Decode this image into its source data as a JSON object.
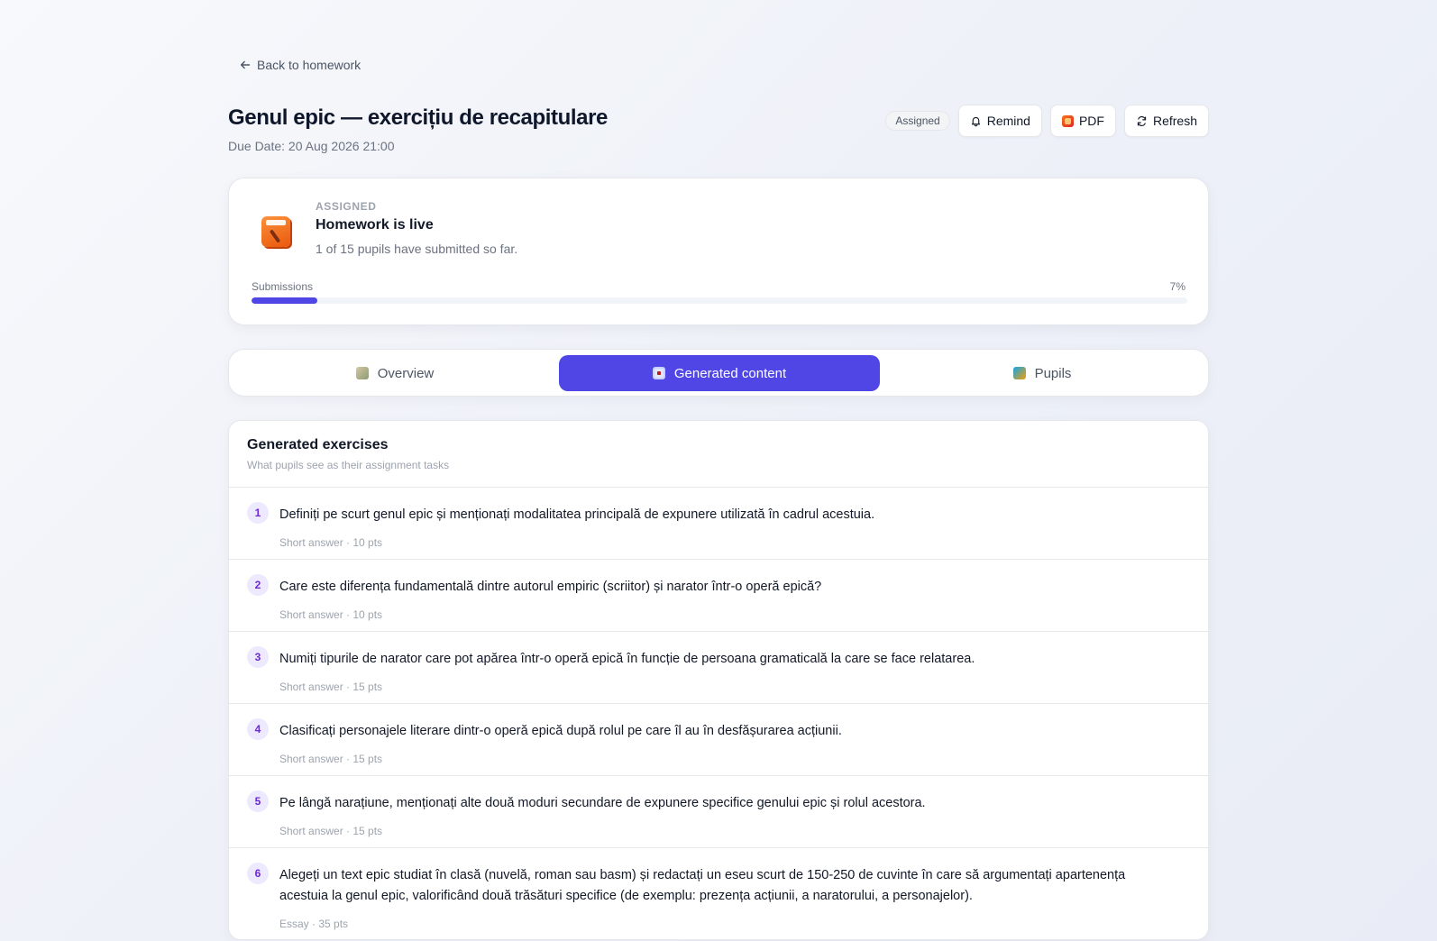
{
  "nav": {
    "back_label": "Back to homework"
  },
  "header": {
    "title": "Genul epic — exercițiu de recapitulare",
    "due_date": "Due Date: 20 Aug 2026 21:00",
    "status_badge": "Assigned",
    "buttons": {
      "remind": "Remind",
      "pdf": "PDF",
      "refresh": "Refresh"
    }
  },
  "status_card": {
    "label": "ASSIGNED",
    "heading": "Homework is live",
    "subtext": "1 of 15 pupils have submitted so far.",
    "progress_label": "Submissions",
    "progress_percent": "7%",
    "progress_fraction": 0.07,
    "icon": "notebook-icon"
  },
  "tabs": [
    {
      "label": "Overview",
      "icon": "overview-icon",
      "active": false
    },
    {
      "label": "Generated content",
      "icon": "generated-content-icon",
      "active": true
    },
    {
      "label": "Pupils",
      "icon": "pupils-icon",
      "active": false
    }
  ],
  "exercises": {
    "title": "Generated exercises",
    "subtitle": "What pupils see as their assignment tasks",
    "items": [
      {
        "number": "1",
        "text": "Definiți pe scurt genul epic și menționați modalitatea principală de expunere utilizată în cadrul acestuia.",
        "meta": "Short answer · 10 pts"
      },
      {
        "number": "2",
        "text": "Care este diferența fundamentală dintre autorul empiric (scriitor) și narator într-o operă epică?",
        "meta": "Short answer · 10 pts"
      },
      {
        "number": "3",
        "text": "Numiți tipurile de narator care pot apărea într-o operă epică în funcție de persoana gramaticală la care se face relatarea.",
        "meta": "Short answer · 15 pts"
      },
      {
        "number": "4",
        "text": "Clasificați personajele literare dintr-o operă epică după rolul pe care îl au în desfășurarea acțiunii.",
        "meta": "Short answer · 15 pts"
      },
      {
        "number": "5",
        "text": "Pe lângă narațiune, menționați alte două moduri secundare de expunere specifice genului epic și rolul acestora.",
        "meta": "Short answer · 15 pts"
      },
      {
        "number": "6",
        "text": "Alegeți un text epic studiat în clasă (nuvelă, roman sau basm) și redactați un eseu scurt de 150-250 de cuvinte în care să argumentați apartenența acestuia la genul epic, valorificând două trăsături specifice (de exemplu: prezența acțiunii, a naratorului, a personajelor).",
        "meta": "Essay · 35 pts"
      }
    ]
  },
  "colors": {
    "accent": "#4f46e5",
    "number_badge_bg": "#ede9fe",
    "number_badge_text": "#6d28d9"
  }
}
